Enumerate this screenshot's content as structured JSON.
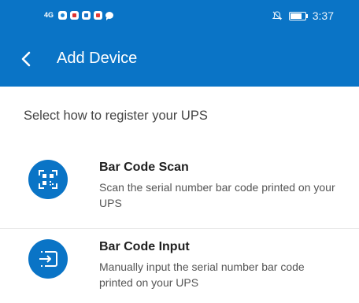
{
  "status_bar": {
    "network": "4G",
    "time": "3:37",
    "icons": [
      "signal-icon",
      "browser-icon",
      "mail-icon",
      "app-icon",
      "app-icon",
      "chat-bubble-icon",
      "mute-icon",
      "battery-icon"
    ]
  },
  "app_bar": {
    "title": "Add Device",
    "back_icon": "chevron-left-icon"
  },
  "page": {
    "subtitle": "Select how to register your UPS"
  },
  "options": [
    {
      "title": "Bar Code Scan",
      "description": "Scan the serial number bar code printed on your UPS",
      "icon": "qr-scan-icon"
    },
    {
      "title": "Bar Code Input",
      "description": "Manually input the serial number bar code printed on your UPS",
      "icon": "input-box-icon"
    }
  ],
  "colors": {
    "primary": "#0a74c6",
    "divider": "#e6e6e6"
  }
}
